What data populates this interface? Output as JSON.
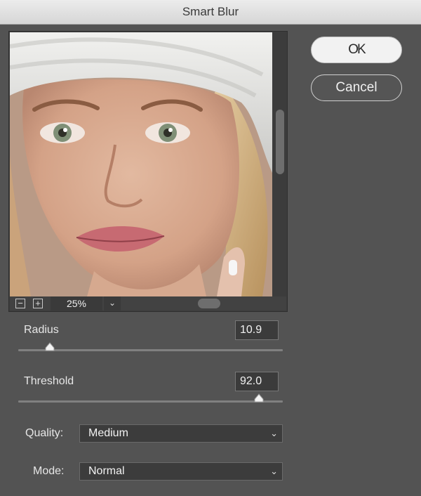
{
  "window": {
    "title": "Smart Blur"
  },
  "preview": {
    "zoom": "25%"
  },
  "buttons": {
    "ok_label": "OK",
    "cancel_label": "Cancel"
  },
  "radius": {
    "label": "Radius",
    "value": "10.9",
    "level": 0.12
  },
  "threshold": {
    "label": "Threshold",
    "value": "92.0",
    "level": 0.91
  },
  "quality": {
    "label": "Quality:",
    "selected": "Medium"
  },
  "mode": {
    "label": "Mode:",
    "selected": "Normal"
  },
  "icons": {
    "zoom_out": "zoom-out-icon",
    "zoom_in": "zoom-in-icon",
    "dropdown": "chevron-down-icon"
  }
}
